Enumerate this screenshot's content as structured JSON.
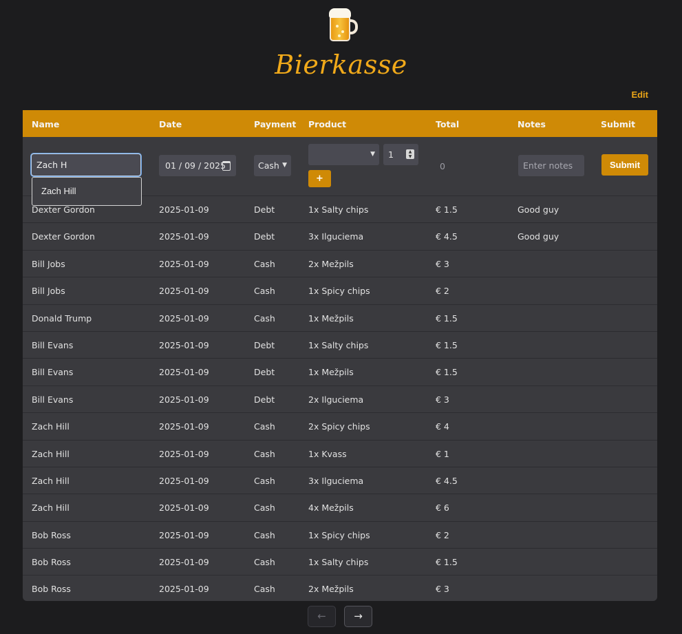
{
  "app": {
    "title": "Bierkasse",
    "logo_icon": "beer-mug-icon",
    "edit_label": "Edit"
  },
  "table": {
    "headers": [
      "Name",
      "Date",
      "Payment",
      "Product",
      "Total",
      "Notes",
      "Submit"
    ],
    "form": {
      "name_value": "Zach H",
      "date_display": "01 / 09 / 2025",
      "payment_value": "Cash",
      "product_value": "",
      "quantity_value": "1",
      "add_label": "+",
      "total_value": "0",
      "notes_placeholder": "Enter notes",
      "submit_label": "Submit"
    },
    "autocomplete": [
      "Zach Hill"
    ],
    "rows": [
      {
        "name": "Dexter Gordon",
        "date": "2025-01-09",
        "payment": "Debt",
        "product": "1x Salty chips",
        "total": "€ 1.5",
        "notes": "Good guy"
      },
      {
        "name": "Dexter Gordon",
        "date": "2025-01-09",
        "payment": "Debt",
        "product": "3x Ilguciema",
        "total": "€ 4.5",
        "notes": "Good guy"
      },
      {
        "name": "Bill Jobs",
        "date": "2025-01-09",
        "payment": "Cash",
        "product": "2x Mežpils",
        "total": "€ 3",
        "notes": ""
      },
      {
        "name": "Bill Jobs",
        "date": "2025-01-09",
        "payment": "Cash",
        "product": "1x Spicy chips",
        "total": "€ 2",
        "notes": ""
      },
      {
        "name": "Donald Trump",
        "date": "2025-01-09",
        "payment": "Cash",
        "product": "1x Mežpils",
        "total": "€ 1.5",
        "notes": ""
      },
      {
        "name": "Bill Evans",
        "date": "2025-01-09",
        "payment": "Debt",
        "product": "1x Salty chips",
        "total": "€ 1.5",
        "notes": ""
      },
      {
        "name": "Bill Evans",
        "date": "2025-01-09",
        "payment": "Debt",
        "product": "1x Mežpils",
        "total": "€ 1.5",
        "notes": ""
      },
      {
        "name": "Bill Evans",
        "date": "2025-01-09",
        "payment": "Debt",
        "product": "2x Ilguciema",
        "total": "€ 3",
        "notes": ""
      },
      {
        "name": "Zach Hill",
        "date": "2025-01-09",
        "payment": "Cash",
        "product": "2x Spicy chips",
        "total": "€ 4",
        "notes": ""
      },
      {
        "name": "Zach Hill",
        "date": "2025-01-09",
        "payment": "Cash",
        "product": "1x Kvass",
        "total": "€ 1",
        "notes": ""
      },
      {
        "name": "Zach Hill",
        "date": "2025-01-09",
        "payment": "Cash",
        "product": "3x Ilguciema",
        "total": "€ 4.5",
        "notes": ""
      },
      {
        "name": "Zach Hill",
        "date": "2025-01-09",
        "payment": "Cash",
        "product": "4x Mežpils",
        "total": "€ 6",
        "notes": ""
      },
      {
        "name": "Bob Ross",
        "date": "2025-01-09",
        "payment": "Cash",
        "product": "1x Spicy chips",
        "total": "€ 2",
        "notes": ""
      },
      {
        "name": "Bob Ross",
        "date": "2025-01-09",
        "payment": "Cash",
        "product": "1x Salty chips",
        "total": "€ 1.5",
        "notes": ""
      },
      {
        "name": "Bob Ross",
        "date": "2025-01-09",
        "payment": "Cash",
        "product": "2x Mežpils",
        "total": "€ 3",
        "notes": ""
      }
    ]
  },
  "pagination": {
    "prev_label": "←",
    "next_label": "→",
    "prev_icon": "arrow-left-icon",
    "next_icon": "arrow-right-icon",
    "prev_disabled": true
  },
  "colors": {
    "accent": "#cf8a06",
    "title": "#f0a91a",
    "background": "#1c1c1e",
    "table_bg": "#3a3a3e"
  }
}
